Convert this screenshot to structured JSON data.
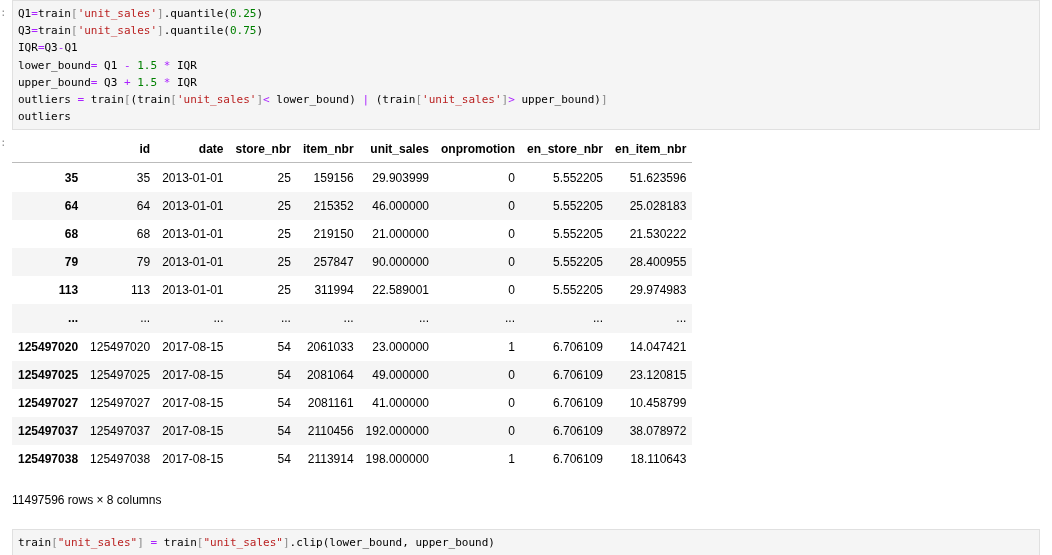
{
  "cells": [
    {
      "kind": "code",
      "prompt": ":",
      "lines": [
        [
          {
            "text": "Q1",
            "kind": "n"
          },
          {
            "text": "=",
            "kind": "o"
          },
          {
            "text": "train",
            "kind": "n"
          },
          {
            "text": "[",
            "kind": "p"
          },
          {
            "text": "'unit_sales'",
            "kind": "s"
          },
          {
            "text": "]",
            "kind": "p"
          },
          {
            "text": ".quantile(",
            "kind": "n"
          },
          {
            "text": "0.25",
            "kind": "d"
          },
          {
            "text": ")",
            "kind": "n"
          }
        ],
        [
          {
            "text": "Q3",
            "kind": "n"
          },
          {
            "text": "=",
            "kind": "o"
          },
          {
            "text": "train",
            "kind": "n"
          },
          {
            "text": "[",
            "kind": "p"
          },
          {
            "text": "'unit_sales'",
            "kind": "s"
          },
          {
            "text": "]",
            "kind": "p"
          },
          {
            "text": ".quantile(",
            "kind": "n"
          },
          {
            "text": "0.75",
            "kind": "d"
          },
          {
            "text": ")",
            "kind": "n"
          }
        ],
        [
          {
            "text": "IQR",
            "kind": "n"
          },
          {
            "text": "=",
            "kind": "o"
          },
          {
            "text": "Q3",
            "kind": "n"
          },
          {
            "text": "-",
            "kind": "o"
          },
          {
            "text": "Q1",
            "kind": "n"
          }
        ],
        [
          {
            "text": "lower_bound",
            "kind": "n"
          },
          {
            "text": "=",
            "kind": "o"
          },
          {
            "text": " Q1 ",
            "kind": "n"
          },
          {
            "text": "-",
            "kind": "o"
          },
          {
            "text": " 1.5 ",
            "kind": "d"
          },
          {
            "text": "*",
            "kind": "o"
          },
          {
            "text": " IQR",
            "kind": "n"
          }
        ],
        [
          {
            "text": "upper_bound",
            "kind": "n"
          },
          {
            "text": "=",
            "kind": "o"
          },
          {
            "text": " Q3 ",
            "kind": "n"
          },
          {
            "text": "+",
            "kind": "o"
          },
          {
            "text": " 1.5 ",
            "kind": "d"
          },
          {
            "text": "*",
            "kind": "o"
          },
          {
            "text": " IQR",
            "kind": "n"
          }
        ],
        [
          {
            "text": "outliers ",
            "kind": "n"
          },
          {
            "text": "=",
            "kind": "o"
          },
          {
            "text": " train",
            "kind": "n"
          },
          {
            "text": "[",
            "kind": "p"
          },
          {
            "text": "(train",
            "kind": "n"
          },
          {
            "text": "[",
            "kind": "p"
          },
          {
            "text": "'unit_sales'",
            "kind": "s"
          },
          {
            "text": "]",
            "kind": "p"
          },
          {
            "text": "<",
            "kind": "o"
          },
          {
            "text": " lower_bound) ",
            "kind": "n"
          },
          {
            "text": "|",
            "kind": "o"
          },
          {
            "text": " (train",
            "kind": "n"
          },
          {
            "text": "[",
            "kind": "p"
          },
          {
            "text": "'unit_sales'",
            "kind": "s"
          },
          {
            "text": "]",
            "kind": "p"
          },
          {
            "text": ">",
            "kind": "o"
          },
          {
            "text": " upper_bound)",
            "kind": "n"
          },
          {
            "text": "]",
            "kind": "p"
          }
        ],
        [
          {
            "text": "outliers",
            "kind": "n"
          }
        ]
      ]
    },
    {
      "kind": "table",
      "prompt": ":",
      "columns": [
        "id",
        "date",
        "store_nbr",
        "item_nbr",
        "unit_sales",
        "onpromotion",
        "en_store_nbr",
        "en_item_nbr"
      ],
      "rows": [
        {
          "index": "35",
          "cells": [
            "35",
            "2013-01-01",
            "25",
            "159156",
            "29.903999",
            "0",
            "5.552205",
            "51.623596"
          ]
        },
        {
          "index": "64",
          "cells": [
            "64",
            "2013-01-01",
            "25",
            "215352",
            "46.000000",
            "0",
            "5.552205",
            "25.028183"
          ]
        },
        {
          "index": "68",
          "cells": [
            "68",
            "2013-01-01",
            "25",
            "219150",
            "21.000000",
            "0",
            "5.552205",
            "21.530222"
          ]
        },
        {
          "index": "79",
          "cells": [
            "79",
            "2013-01-01",
            "25",
            "257847",
            "90.000000",
            "0",
            "5.552205",
            "28.400955"
          ]
        },
        {
          "index": "113",
          "cells": [
            "113",
            "2013-01-01",
            "25",
            "311994",
            "22.589001",
            "0",
            "5.552205",
            "29.974983"
          ]
        },
        {
          "index": "...",
          "cells": [
            "...",
            "...",
            "...",
            "...",
            "...",
            "...",
            "...",
            "..."
          ]
        },
        {
          "index": "125497020",
          "cells": [
            "125497020",
            "2017-08-15",
            "54",
            "2061033",
            "23.000000",
            "1",
            "6.706109",
            "14.047421"
          ]
        },
        {
          "index": "125497025",
          "cells": [
            "125497025",
            "2017-08-15",
            "54",
            "2081064",
            "49.000000",
            "0",
            "6.706109",
            "23.120815"
          ]
        },
        {
          "index": "125497027",
          "cells": [
            "125497027",
            "2017-08-15",
            "54",
            "2081161",
            "41.000000",
            "0",
            "6.706109",
            "10.458799"
          ]
        },
        {
          "index": "125497037",
          "cells": [
            "125497037",
            "2017-08-15",
            "54",
            "2110456",
            "192.000000",
            "0",
            "6.706109",
            "38.078972"
          ]
        },
        {
          "index": "125497038",
          "cells": [
            "125497038",
            "2017-08-15",
            "54",
            "2113914",
            "198.000000",
            "1",
            "6.706109",
            "18.110643"
          ]
        }
      ],
      "summary": "11497596 rows × 8 columns"
    },
    {
      "kind": "code",
      "lines": [
        [
          {
            "text": "train",
            "kind": "n"
          },
          {
            "text": "[",
            "kind": "p"
          },
          {
            "text": "\"unit_sales\"",
            "kind": "s"
          },
          {
            "text": "] ",
            "kind": "p"
          },
          {
            "text": "=",
            "kind": "o"
          },
          {
            "text": " train",
            "kind": "n"
          },
          {
            "text": "[",
            "kind": "p"
          },
          {
            "text": "\"unit_sales\"",
            "kind": "s"
          },
          {
            "text": "]",
            "kind": "p"
          },
          {
            "text": ".clip(lower_bound, upper_bound)",
            "kind": "n"
          }
        ]
      ]
    }
  ]
}
